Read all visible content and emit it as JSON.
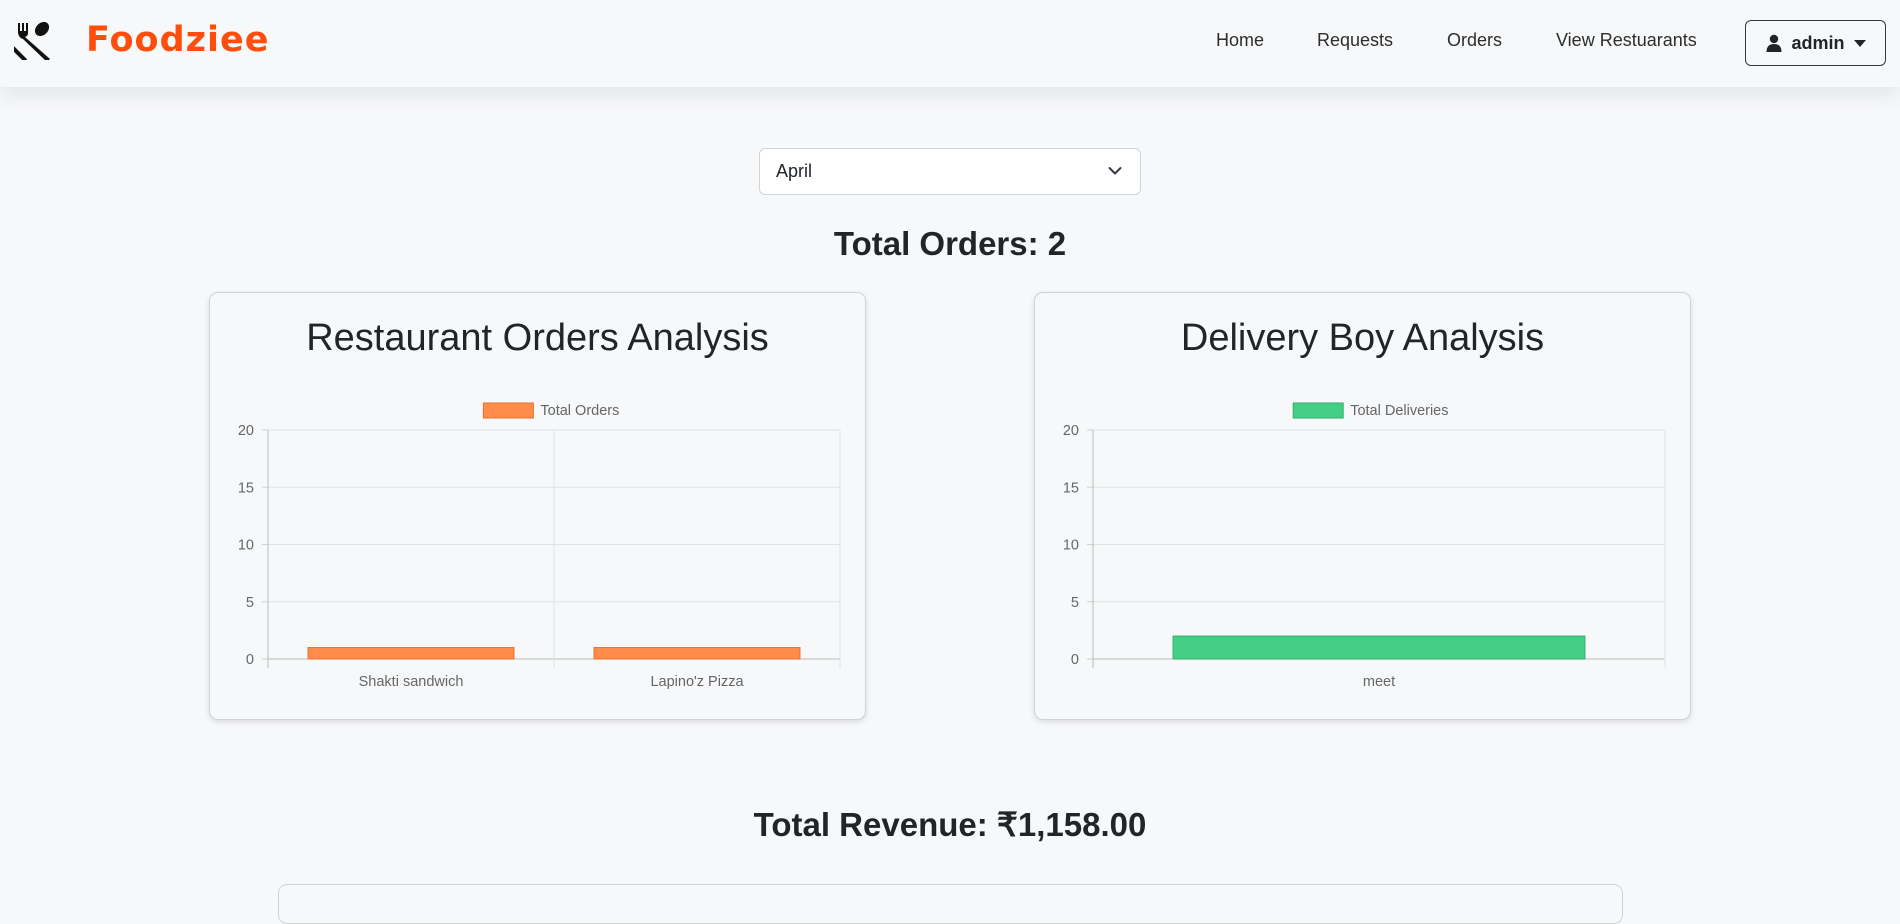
{
  "brand": {
    "name": "Foodziee"
  },
  "nav": {
    "links": [
      {
        "label": "Home"
      },
      {
        "label": "Requests"
      },
      {
        "label": "Orders"
      },
      {
        "label": "View Restuarants"
      }
    ],
    "user_label": "admin"
  },
  "filter": {
    "selected_month": "April"
  },
  "summary": {
    "total_orders": "Total Orders: 2",
    "total_revenue": "Total Revenue: ₹1,158.00"
  },
  "cards": [
    {
      "title": "Restaurant Orders Analysis"
    },
    {
      "title": "Delivery Boy Analysis"
    }
  ],
  "colors": {
    "brand": "#ff4d0d",
    "orders_bar": "#ff8c4a",
    "deliveries_bar": "#45cf86"
  },
  "chart_data": [
    {
      "type": "bar",
      "title": "",
      "categories": [
        "Shakti sandwich",
        "Lapino'z Pizza"
      ],
      "series": [
        {
          "name": "Total Orders",
          "values": [
            1,
            1
          ]
        }
      ],
      "ylim": [
        0,
        20
      ],
      "yticks": [
        0,
        5,
        10,
        15,
        20
      ],
      "grid": true,
      "legend": "top"
    },
    {
      "type": "bar",
      "title": "",
      "categories": [
        "meet"
      ],
      "series": [
        {
          "name": "Total Deliveries",
          "values": [
            2
          ]
        }
      ],
      "ylim": [
        0,
        20
      ],
      "yticks": [
        0,
        5,
        10,
        15,
        20
      ],
      "grid": true,
      "legend": "top"
    }
  ]
}
